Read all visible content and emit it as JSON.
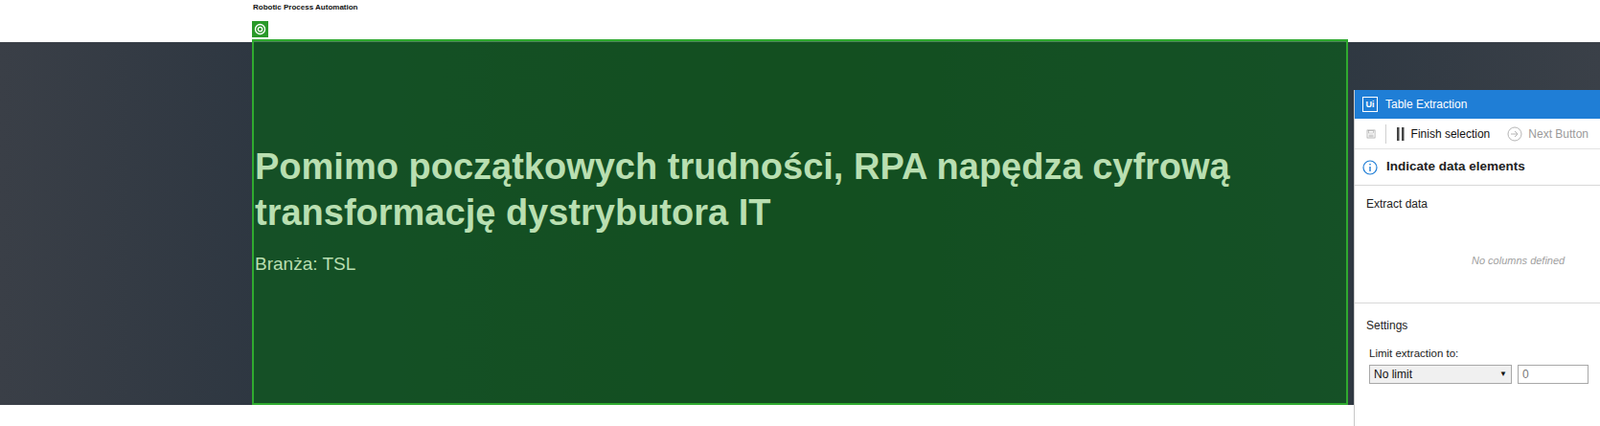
{
  "header": {
    "brand": "Robotic Process Automation"
  },
  "hero": {
    "title_lines": [
      "Pomimo początkowych trudności, RPA napędza cyfrową",
      "transformację dystrybutora IT"
    ],
    "industry": "Branża: TSL",
    "selected": true
  },
  "panel": {
    "logo": "Ui",
    "title": "Table Extraction",
    "toolbar": [
      {
        "label": "Finish selection",
        "disabled": false
      },
      {
        "label": "Next Button",
        "disabled": true
      }
    ],
    "instruction": "Indicate data elements",
    "extract_data": {
      "heading": "Extract data",
      "empty_text": "No columns defined"
    },
    "settings": {
      "heading": "Settings",
      "limit_label": "Limit extraction to:",
      "limit_value": "No limit",
      "limit_arrow": "▼",
      "limit_count": "0"
    }
  }
}
